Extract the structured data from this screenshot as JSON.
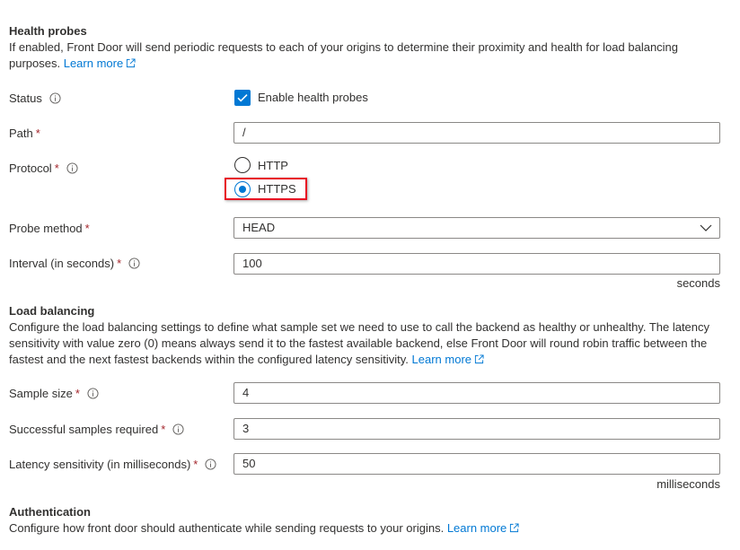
{
  "health_probes": {
    "title": "Health probes",
    "description": "If enabled, Front Door will send periodic requests to each of your origins to determine their proximity and health for load balancing purposes.",
    "learn_more": "Learn more",
    "status": {
      "label": "Status",
      "checkbox_label": "Enable health probes",
      "checked": true
    },
    "path": {
      "label": "Path",
      "required": "*",
      "value": "/"
    },
    "protocol": {
      "label": "Protocol",
      "required": "*",
      "options": [
        {
          "label": "HTTP",
          "selected": false
        },
        {
          "label": "HTTPS",
          "selected": true
        }
      ]
    },
    "probe_method": {
      "label": "Probe method",
      "required": "*",
      "value": "HEAD"
    },
    "interval": {
      "label": "Interval (in seconds)",
      "required": "*",
      "value": "100",
      "suffix": "seconds"
    }
  },
  "load_balancing": {
    "title": "Load balancing",
    "description": "Configure the load balancing settings to define what sample set we need to use to call the backend as healthy or unhealthy. The latency sensitivity with value zero (0) means always send it to the fastest available backend, else Front Door will round robin traffic between the fastest and the next fastest backends within the configured latency sensitivity.",
    "learn_more": "Learn more",
    "sample_size": {
      "label": "Sample size",
      "required": "*",
      "value": "4"
    },
    "successful_samples": {
      "label": "Successful samples required",
      "required": "*",
      "value": "3"
    },
    "latency_sensitivity": {
      "label": "Latency sensitivity (in milliseconds)",
      "required": "*",
      "value": "50",
      "suffix": "milliseconds"
    }
  },
  "authentication": {
    "title": "Authentication",
    "description": "Configure how front door should authenticate while sending requests to your origins.",
    "learn_more": "Learn more"
  },
  "colors": {
    "accent": "#0078d4",
    "required": "#a4262c",
    "highlight": "#e81123",
    "text": "#323130",
    "border": "#8a8886"
  },
  "icons": {
    "info": "info-icon",
    "external": "external-link-icon",
    "chevron": "chevron-down-icon",
    "check": "checkmark-icon"
  }
}
